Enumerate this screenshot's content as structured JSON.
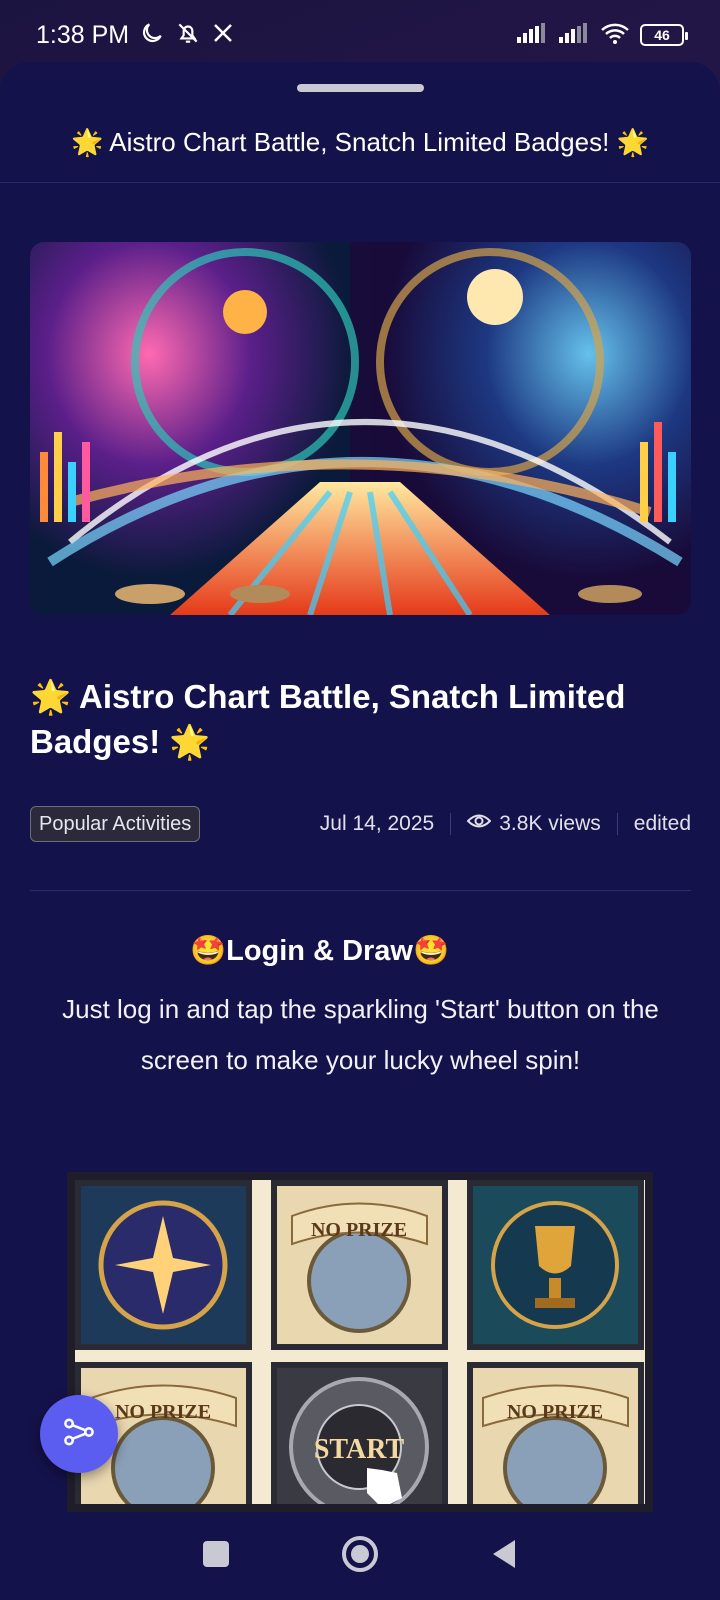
{
  "status": {
    "time": "1:38 PM",
    "battery": "46"
  },
  "sheet": {
    "header_title": "🌟 Aistro Chart Battle, Snatch Limited Badges! 🌟"
  },
  "article": {
    "title": "🌟 Aistro Chart Battle, Snatch Limited Badges! 🌟",
    "tag": "Popular Activities",
    "date": "Jul 14, 2025",
    "views": "3.8K views",
    "edited": "edited",
    "section_title": "🤩Login & Draw🤩",
    "body": "Just log in and tap the sparkling 'Start' button on the screen to make your lucky wheel spin!"
  },
  "game": {
    "no_prize": "NO PRIZE",
    "start": "START"
  },
  "icons": {
    "moon": "moon-icon",
    "bell_off": "bell-off-icon",
    "x_logo": "x-logo-icon",
    "signal": "signal-icon",
    "wifi": "wifi-icon",
    "eye": "eye-icon",
    "share": "share-icon"
  }
}
